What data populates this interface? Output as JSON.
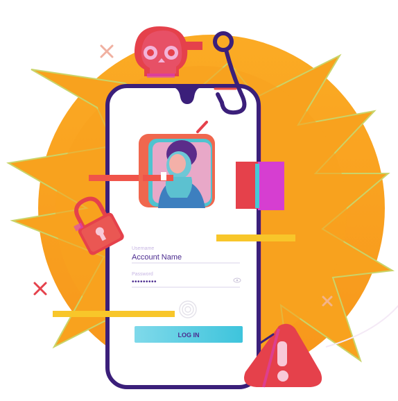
{
  "login": {
    "username_label": "Username",
    "username_value": "Account Name",
    "password_label": "Password",
    "password_mask": "•••••••••",
    "button_label": "LOG IN"
  },
  "icons": [
    "skull-icon",
    "fishing-hook-icon",
    "padlock-icon",
    "warning-icon",
    "fingerprint-icon",
    "eye-icon"
  ],
  "colors": {
    "burst_orange": "#f8a21e",
    "phone_outline": "#3b1f7a",
    "accent_red": "#e5414b",
    "accent_magenta": "#d63ed1",
    "accent_teal": "#47c8d6",
    "accent_yellow": "#f8c62a",
    "label_purple": "#4b2b8f"
  }
}
